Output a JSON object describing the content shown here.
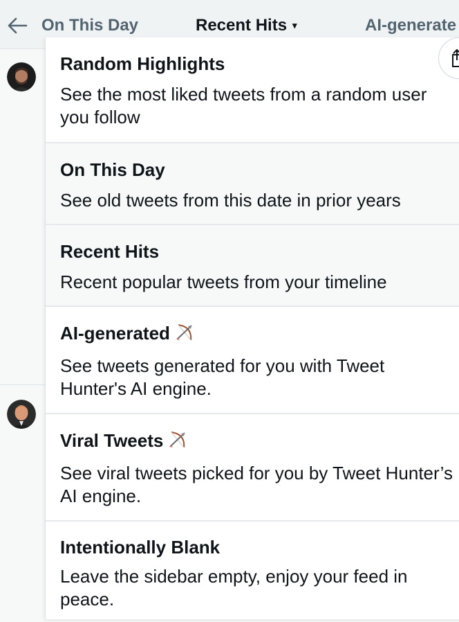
{
  "nav": {
    "back_icon": "arrow-left-icon",
    "tabs": [
      {
        "label": "On This Day"
      },
      {
        "label": "Recent Hits",
        "caret": "▾"
      },
      {
        "label": "AI-generate"
      }
    ]
  },
  "menu": {
    "items": [
      {
        "title": "Random Highlights",
        "description": "See the most liked tweets from a random user you follow"
      },
      {
        "title": "On This Day",
        "description": "See old tweets from this date in prior years"
      },
      {
        "title": "Recent Hits",
        "description": "Recent popular tweets from your timeline"
      },
      {
        "title": "AI-generated",
        "description": "See tweets generated for you with Tweet Hunter's AI engine.",
        "icon": "bow-and-arrow-icon"
      },
      {
        "title": "Viral Tweets",
        "description": "See viral tweets picked for you by Tweet Hunter’s AI engine.",
        "icon": "bow-and-arrow-icon"
      },
      {
        "title": "Intentionally Blank",
        "description": "Leave the sidebar empty, enjoy your feed in peace."
      }
    ]
  },
  "colors": {
    "text_primary": "#0f1419",
    "text_secondary": "#536471",
    "highlight_bg": "#f7f9f9",
    "topbar_bg": "#eff3f4"
  }
}
